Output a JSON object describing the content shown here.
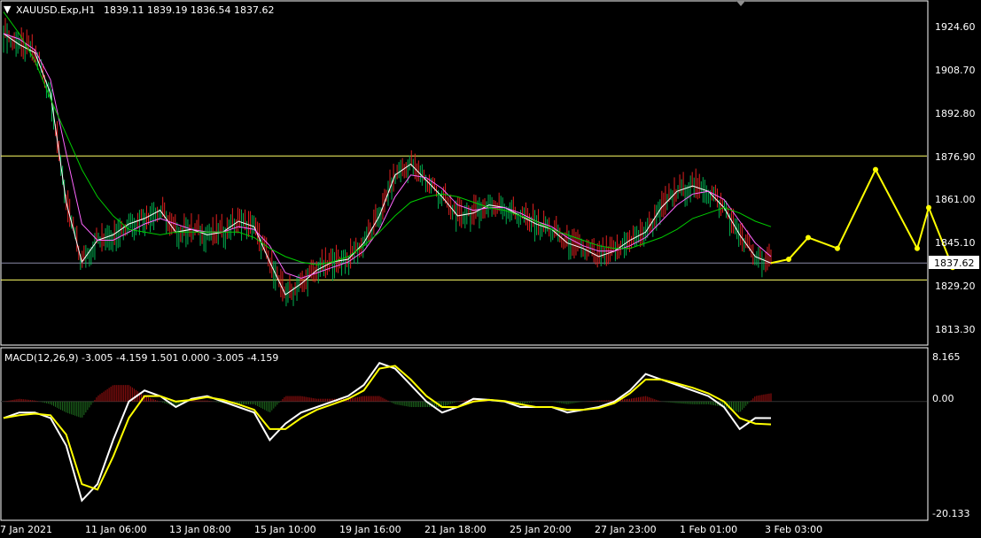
{
  "header": {
    "symbol_label": "XAUUSD.Exp,H1",
    "ohlc_label": "1839.11 1839.19 1836.54 1837.62"
  },
  "price_panel": {
    "y_ticks": [
      "1924.60",
      "1908.70",
      "1892.80",
      "1876.90",
      "1861.00",
      "1845.10",
      "1829.20",
      "1813.30"
    ],
    "current_price_label": "1837.62",
    "horizontal_levels": [
      1877.0,
      1831.4
    ],
    "current_price_line": 1837.62
  },
  "macd_panel": {
    "label": "MACD(12,26,9) -3.005 -4.159 1.501 0.000 -3.005 -4.159",
    "y_ticks": [
      "8.165",
      "0.00",
      "-20.133"
    ]
  },
  "x_ticks": [
    "7 Jan 2021",
    "11 Jan 06:00",
    "13 Jan 08:00",
    "15 Jan 10:00",
    "19 Jan 16:00",
    "21 Jan 18:00",
    "25 Jan 20:00",
    "27 Jan 23:00",
    "1 Feb 01:00",
    "3 Feb 03:00"
  ],
  "colors": {
    "background": "#000000",
    "bull_candle": "#00b050",
    "bear_candle": "#e02020",
    "ma_fast": "#ffffff",
    "ma_mid": "#ff66ff",
    "ma_slow": "#00cc00",
    "level_line": "#ffff66",
    "forecast_arrow": "#ffff00",
    "macd_main": "#ffffff",
    "macd_signal": "#ffff00",
    "hist_pos": "#a01010",
    "hist_neg": "#1f6f1f"
  },
  "chart_data": {
    "type": "line",
    "title": "XAUUSD.Exp,H1",
    "ylim": [
      1806,
      1936
    ],
    "x_categories": [
      "7 Jan 2021",
      "11 Jan 06:00",
      "13 Jan 08:00",
      "15 Jan 10:00",
      "19 Jan 16:00",
      "21 Jan 18:00",
      "25 Jan 20:00",
      "27 Jan 23:00",
      "1 Feb 01:00",
      "3 Feb 03:00"
    ],
    "series": [
      {
        "values": [
          1922,
          1918,
          1915,
          1900,
          1860,
          1838,
          1846,
          1848,
          1852,
          1854,
          1857,
          1849,
          1850,
          1848,
          1849,
          1853,
          1851,
          1838,
          1826,
          1830,
          1835,
          1838,
          1839,
          1845,
          1855,
          1870,
          1874,
          1868,
          1862,
          1855,
          1856,
          1859,
          1858,
          1855,
          1852,
          1850,
          1845,
          1843,
          1840,
          1842,
          1846,
          1849,
          1858,
          1864,
          1866,
          1864,
          1858,
          1848,
          1840,
          1837.62
        ]
      },
      {
        "values": [
          1922,
          1920,
          1916,
          1905,
          1878,
          1852,
          1846,
          1846,
          1849,
          1852,
          1854,
          1852,
          1850,
          1849,
          1849,
          1851,
          1850,
          1844,
          1834,
          1832,
          1834,
          1836,
          1838,
          1842,
          1850,
          1862,
          1870,
          1869,
          1865,
          1859,
          1857,
          1858,
          1858,
          1856,
          1853,
          1851,
          1847,
          1844,
          1842,
          1842,
          1844,
          1847,
          1853,
          1859,
          1863,
          1864,
          1861,
          1853,
          1845,
          1840
        ]
      },
      {
        "values": [
          1930,
          1922,
          1912,
          1898,
          1885,
          1872,
          1862,
          1855,
          1850,
          1849,
          1848,
          1849,
          1849,
          1849,
          1849,
          1849,
          1847,
          1843,
          1840,
          1838,
          1837,
          1838,
          1840,
          1844,
          1849,
          1855,
          1860,
          1862,
          1863,
          1862,
          1860,
          1858,
          1857,
          1855,
          1853,
          1850,
          1848,
          1846,
          1844,
          1843,
          1843,
          1845,
          1847,
          1850,
          1854,
          1856,
          1858,
          1856,
          1853,
          1851
        ]
      }
    ],
    "forecast_path": [
      1837.62,
      1839,
      1847,
      1843,
      1872,
      1843,
      1858,
      1836
    ],
    "horizontal_levels": [
      1877.0,
      1831.4
    ],
    "macd": {
      "ylim": [
        -20.133,
        8.165
      ],
      "macd_line": [
        -3,
        -2,
        -2,
        -3,
        -8,
        -18,
        -15,
        -7,
        0,
        2,
        1,
        -1,
        0.5,
        1,
        0,
        -1,
        -2,
        -7,
        -4,
        -2,
        -1,
        0,
        1,
        3,
        7,
        6,
        3,
        0,
        -2,
        -1,
        0.5,
        0.3,
        0,
        -1,
        -1,
        -1,
        -2,
        -1.5,
        -1,
        0,
        2,
        5,
        4,
        3,
        2,
        1,
        -1,
        -5,
        -3,
        -3.005
      ],
      "signal_line": [
        -3,
        -2.5,
        -2.2,
        -2.5,
        -6,
        -15,
        -16,
        -10,
        -3,
        1,
        1,
        0,
        0.3,
        0.8,
        0.3,
        -0.5,
        -1.5,
        -5,
        -5,
        -3,
        -1.5,
        -0.5,
        0.5,
        2,
        6,
        6.5,
        4,
        1,
        -1,
        -1,
        0,
        0.3,
        0.1,
        -0.5,
        -1,
        -1,
        -1.5,
        -1.5,
        -1.2,
        -0.3,
        1.5,
        4,
        4,
        3.3,
        2.5,
        1.5,
        0,
        -3,
        -4,
        -4.159
      ],
      "histogram": [
        0,
        0.5,
        0.2,
        -0.5,
        -2,
        -3,
        1,
        3,
        3,
        1,
        0,
        -1,
        0.2,
        0.2,
        -0.3,
        -0.5,
        -0.5,
        -2,
        1,
        1,
        0.5,
        0.5,
        0.5,
        1,
        1,
        -0.5,
        -1,
        -1,
        -1,
        0,
        0.5,
        0,
        -0.1,
        -0.5,
        0,
        0,
        -0.5,
        0,
        0.2,
        0.3,
        0.5,
        1,
        0,
        -0.3,
        -0.5,
        -0.5,
        -1,
        -2,
        1,
        1.5
      ]
    }
  }
}
